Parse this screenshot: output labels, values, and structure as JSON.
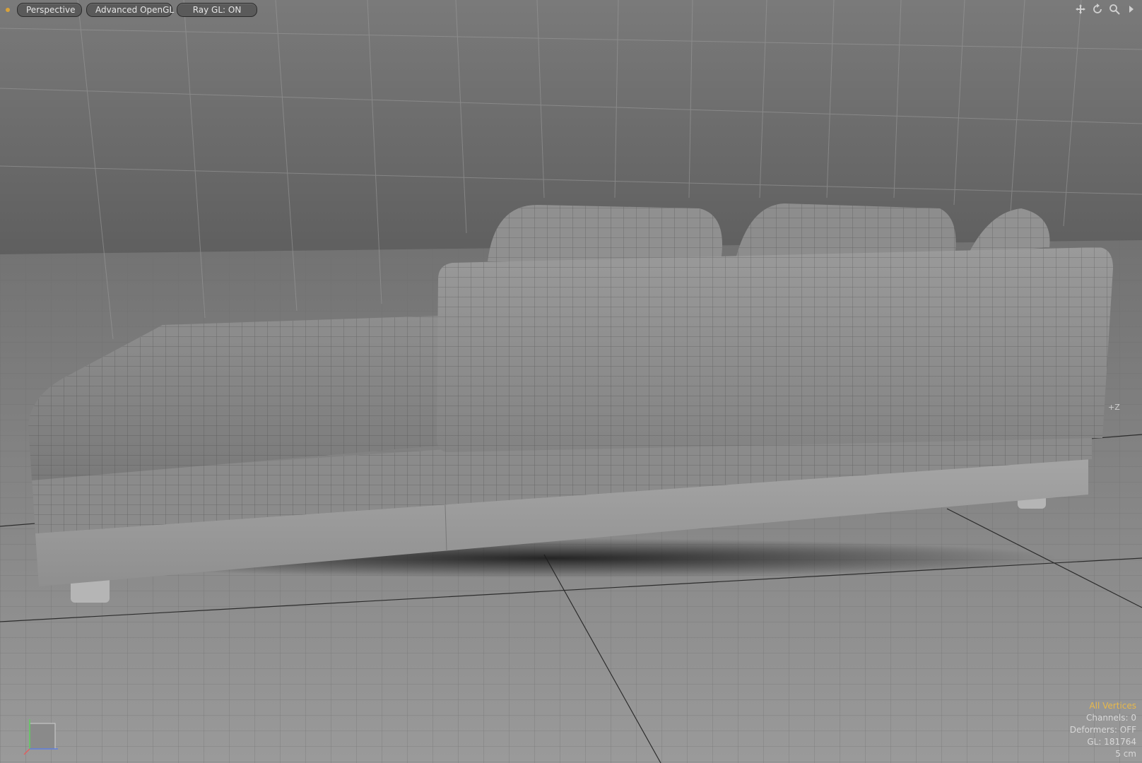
{
  "toolbar": {
    "view_label": "Perspective",
    "shading_label": "Advanced OpenGL",
    "raygl_label": "Ray GL: ON"
  },
  "icons": {
    "move": "pan-icon",
    "rotate": "rotate-icon",
    "zoom": "zoom-icon",
    "menu": "menu-arrow-icon"
  },
  "axis": {
    "plus_z": "+Z"
  },
  "info": {
    "selection_mode": "All Vertices",
    "channels": "Channels: 0",
    "deformers": "Deformers: OFF",
    "gl": "GL: 181764",
    "grid_unit": "5 cm"
  },
  "colors": {
    "accent": "#e8b84a",
    "background_top": "#6a6a6a",
    "floor": "#8a8a8a"
  }
}
